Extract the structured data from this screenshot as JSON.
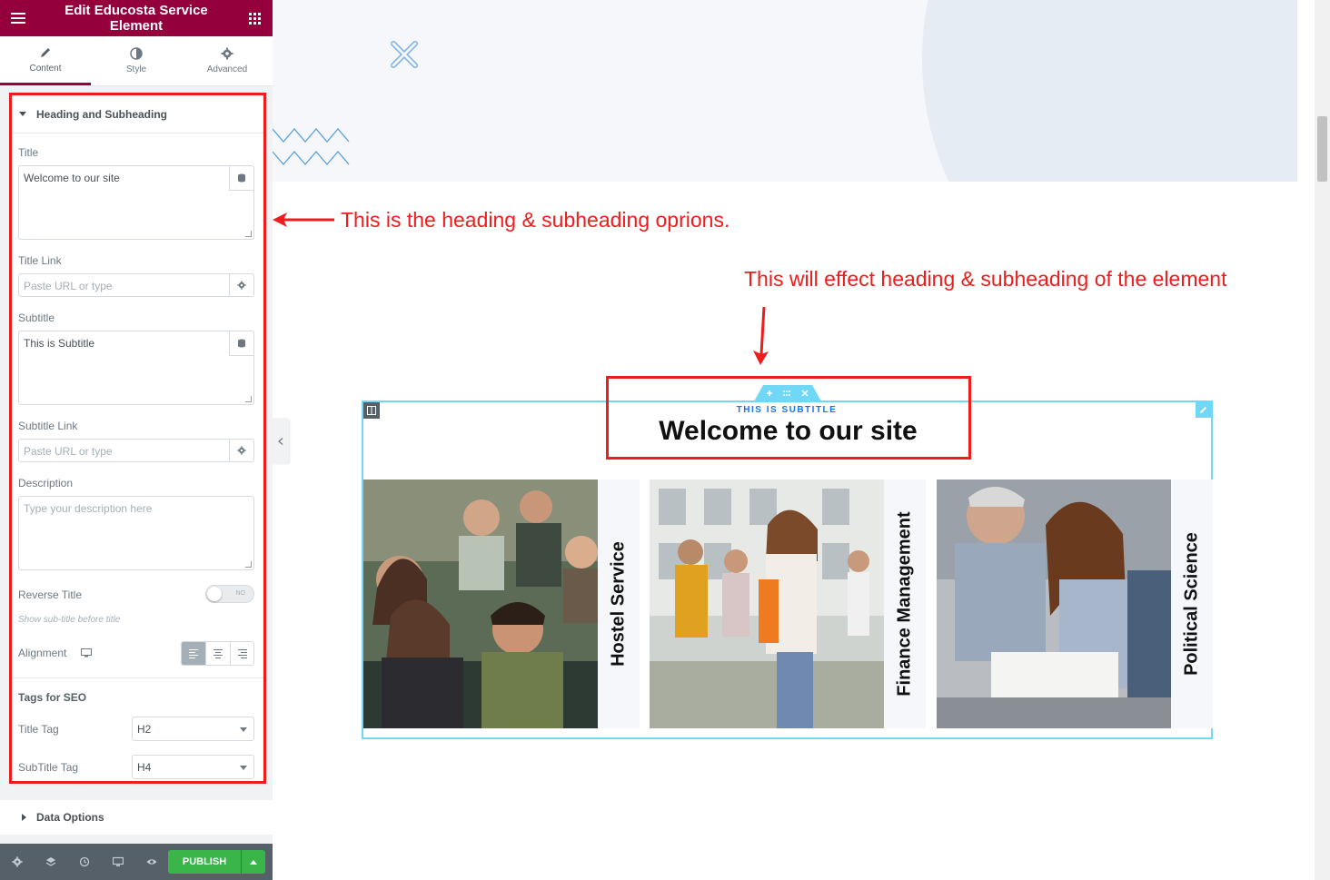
{
  "header": {
    "title": "Edit Educosta Service Element"
  },
  "tabs": [
    {
      "label": "Content"
    },
    {
      "label": "Style"
    },
    {
      "label": "Advanced"
    }
  ],
  "section": {
    "title": "Heading and Subheading",
    "title_label": "Title",
    "title_value": "Welcome to our site",
    "title_link_label": "Title Link",
    "title_link_placeholder": "Paste URL or type",
    "subtitle_label": "Subtitle",
    "subtitle_value": "This is Subtitle",
    "subtitle_link_label": "Subtitle Link",
    "subtitle_link_placeholder": "Paste URL or type",
    "description_label": "Description",
    "description_placeholder": "Type your description here",
    "reverse_label": "Reverse Title",
    "reverse_state": "NO",
    "reverse_hint": "Show sub-title before title",
    "alignment_label": "Alignment",
    "seo_heading": "Tags for SEO",
    "title_tag_label": "Title Tag",
    "title_tag_value": "H2",
    "subtitle_tag_label": "SubTitle Tag",
    "subtitle_tag_value": "H4"
  },
  "data_options": {
    "title": "Data Options"
  },
  "footer": {
    "publish_label": "PUBLISH"
  },
  "annotations": {
    "note1": "This is the heading & subheading oprions.",
    "note2": "This will effect heading & subheading of the element"
  },
  "widget": {
    "subtitle": "THIS IS SUBTITLE",
    "title": "Welcome to our site",
    "cards": [
      {
        "label": "Hostel Service"
      },
      {
        "label": "Finance Management"
      },
      {
        "label": "Political Science"
      }
    ]
  },
  "colors": {
    "brand": "#93003c",
    "publish": "#39b54a",
    "highlight": "#ee1c1c",
    "widget_border": "#71d7f7",
    "subtitle_blue": "#1a73e8"
  }
}
